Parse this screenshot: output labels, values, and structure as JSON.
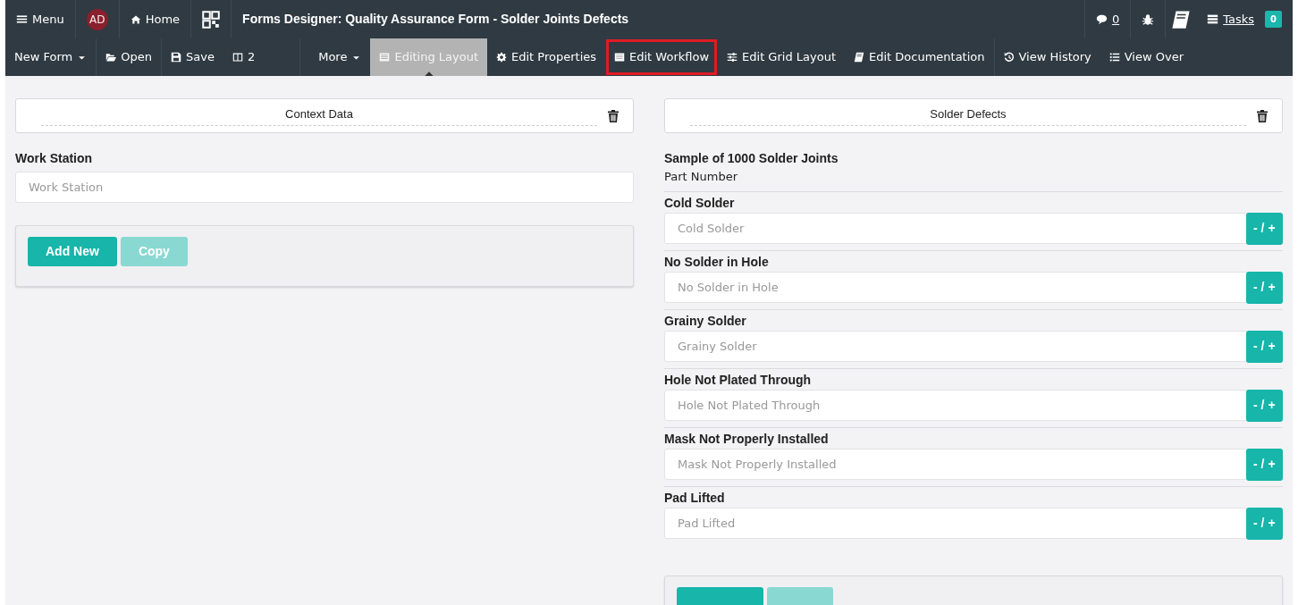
{
  "top_bar": {
    "menu": "Menu",
    "avatar": "AD",
    "home": "Home",
    "title": "Forms Designer: Quality Assurance Form - Solder Joints Defects",
    "comments": "0",
    "tasks": "Tasks",
    "tasks_count": "0"
  },
  "toolbar": [
    {
      "kind": "dropdown",
      "label": "New Form",
      "selected": false,
      "highlighted": false
    },
    {
      "kind": "button",
      "label": "Open",
      "selected": false,
      "highlighted": false
    },
    {
      "kind": "button",
      "label": "Save",
      "selected": false,
      "highlighted": false
    },
    {
      "kind": "button",
      "label": "2",
      "selected": false,
      "highlighted": false
    },
    {
      "kind": "dropdown",
      "label": "More",
      "selected": false,
      "highlighted": false
    },
    {
      "kind": "button",
      "label": "Editing Layout",
      "selected": true,
      "highlighted": false
    },
    {
      "kind": "button",
      "label": "Edit Properties",
      "selected": false,
      "highlighted": false
    },
    {
      "kind": "button",
      "label": "Edit Workflow",
      "selected": false,
      "highlighted": true
    },
    {
      "kind": "button",
      "label": "Edit Grid Layout",
      "selected": false,
      "highlighted": false
    },
    {
      "kind": "button",
      "label": "Edit Documentation",
      "selected": false,
      "highlighted": false
    },
    {
      "kind": "button",
      "label": "View History",
      "selected": false,
      "highlighted": false
    },
    {
      "kind": "button",
      "label": "View Over",
      "selected": false,
      "highlighted": false
    }
  ],
  "sections": [
    {
      "title": "Context Data",
      "fields": [
        {
          "kind": "text",
          "label": "Work Station",
          "placeholder": "Work Station"
        }
      ],
      "buttons": [
        {
          "label": "Add New",
          "disabled": false
        },
        {
          "label": "Copy",
          "disabled": true
        }
      ]
    },
    {
      "title": "Solder Defects",
      "fields": [
        {
          "kind": "heading",
          "label": "Sample of 1000 Solder Joints",
          "note": "Part Number"
        },
        {
          "kind": "counter",
          "label": "Cold Solder",
          "placeholder": "Cold Solder",
          "button": "- / +"
        },
        {
          "kind": "counter",
          "label": "No Solder in Hole",
          "placeholder": "No Solder in Hole",
          "button": "- / +"
        },
        {
          "kind": "counter",
          "label": "Grainy Solder",
          "placeholder": "Grainy Solder",
          "button": "- / +"
        },
        {
          "kind": "counter",
          "label": "Hole Not Plated Through",
          "placeholder": "Hole Not Plated Through",
          "button": "- / +"
        },
        {
          "kind": "counter",
          "label": "Mask Not Properly Installed",
          "placeholder": "Mask Not Properly Installed",
          "button": "- / +"
        },
        {
          "kind": "counter",
          "label": "Pad Lifted",
          "placeholder": "Pad Lifted",
          "button": "- / +"
        }
      ],
      "buttons": [
        {
          "disabled": false
        },
        {
          "disabled": true
        }
      ]
    }
  ]
}
